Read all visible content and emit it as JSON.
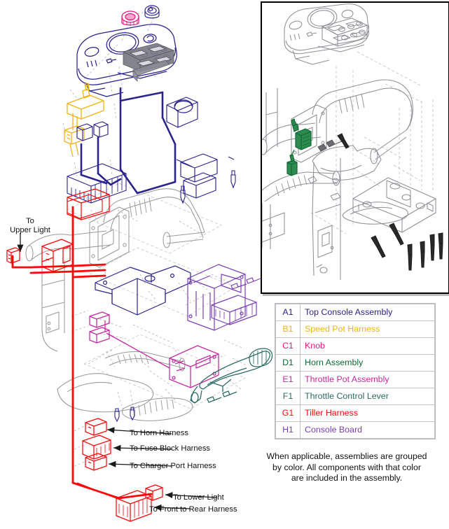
{
  "document": {
    "type": "exploded-parts-diagram",
    "subject": "Tiller console assembly wiring diagram"
  },
  "inset": {
    "name": "tiller-assembly-detail-view",
    "description": "Gray line-art detail view of tiller shroud, console and horn mounting with screws"
  },
  "legend": {
    "rows": [
      {
        "code": "A1",
        "label": "Top Console Assembly",
        "color": "#2a238c"
      },
      {
        "code": "B1",
        "label": "Speed Pot Harness",
        "color": "#f0b418"
      },
      {
        "code": "C1",
        "label": "Knob",
        "color": "#e8147f"
      },
      {
        "code": "D1",
        "label": "Horn Assembly",
        "color": "#0c6b34"
      },
      {
        "code": "E1",
        "label": "Throttle Pot Assembly",
        "color": "#c22ba0"
      },
      {
        "code": "F1",
        "label": "Throttle Control Lever",
        "color": "#2b6b63"
      },
      {
        "code": "G1",
        "label": "Tiller Harness",
        "color": "#fb0808"
      },
      {
        "code": "H1",
        "label": "Console Board",
        "color": "#7b3fb5"
      }
    ],
    "note_lines": [
      "When applicable, assemblies are grouped",
      "by color. All components with that color",
      "are included in the assembly."
    ]
  },
  "callouts": {
    "upper_light_line1": "To",
    "upper_light_line2": "Upper Light",
    "horn_harness": "To Horn Harness",
    "fuse_block_harness": "To Fuse Block Harness",
    "charger_port_harness": "To Charger Port Harness",
    "lower_light": "To Lower Light",
    "front_to_rear_harness": "To Front to Rear Harness"
  },
  "colors": {
    "navy": "#2a238c",
    "yellow": "#f0b418",
    "magenta": "#e8147f",
    "green": "#0c6b34",
    "orchid": "#c22ba0",
    "teal": "#2b6b63",
    "red": "#fb0808",
    "purple": "#7b3fb5",
    "gray_line": "#9a9a9e",
    "dash_gray": "#b5b5ba",
    "black": "#1a1a1a",
    "panel_border": "#000000",
    "table_border": "#c3c3c7"
  }
}
